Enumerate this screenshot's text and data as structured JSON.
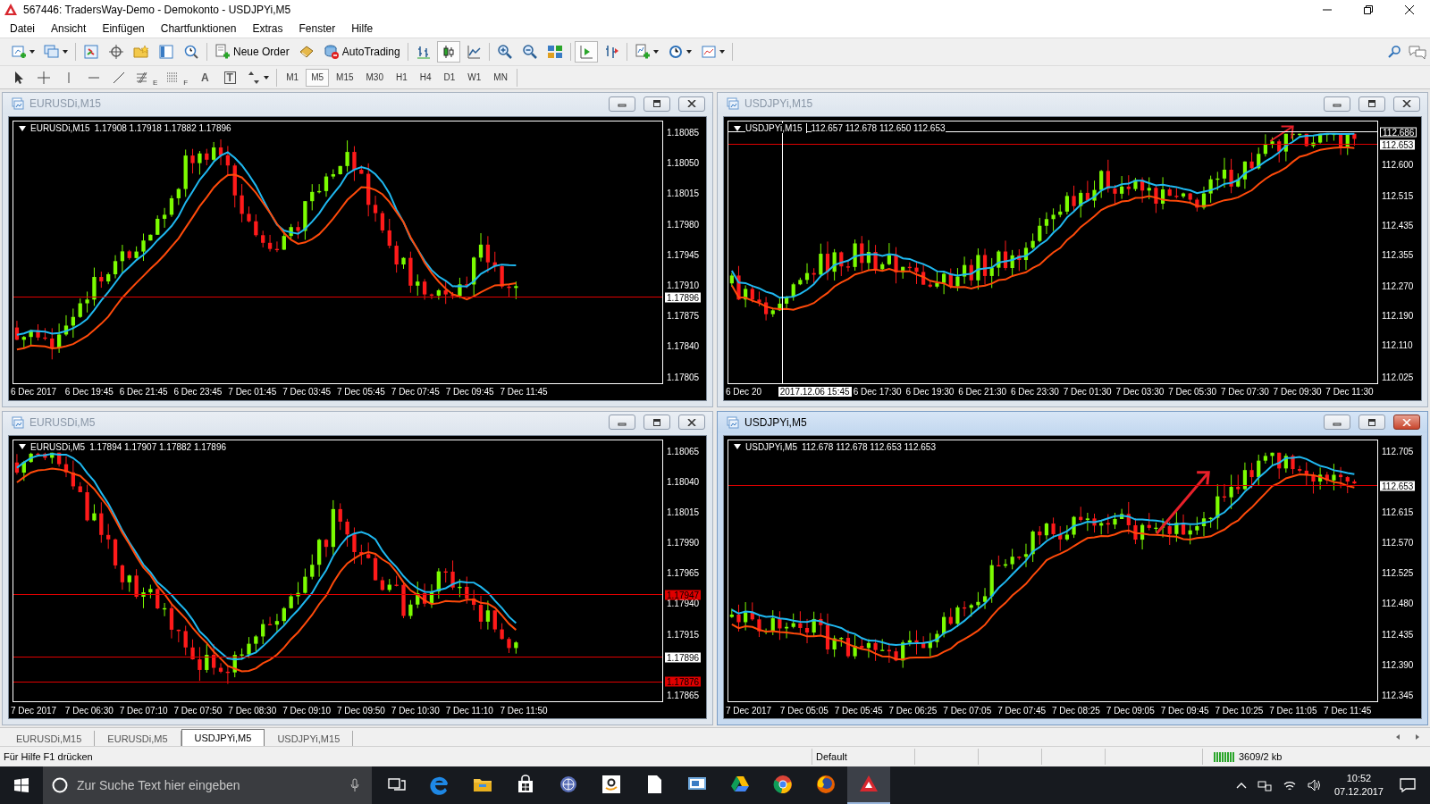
{
  "window": {
    "title": "567446: TradersWay-Demo - Demokonto - USDJPYi,M5"
  },
  "menu": [
    "Datei",
    "Ansicht",
    "Einfügen",
    "Chartfunktionen",
    "Extras",
    "Fenster",
    "Hilfe"
  ],
  "toolbar": {
    "groups": [
      [
        {
          "kind": "new-chart",
          "dropdown": true
        },
        {
          "kind": "profiles",
          "dropdown": true
        }
      ],
      [
        {
          "kind": "market-watch"
        },
        {
          "kind": "data-window"
        },
        {
          "kind": "navigator"
        },
        {
          "kind": "terminal"
        },
        {
          "kind": "tester"
        }
      ],
      [
        {
          "kind": "new-order",
          "label": "Neue Order"
        },
        {
          "kind": "editor"
        },
        {
          "kind": "autotrading",
          "label": "AutoTrading"
        }
      ],
      [
        {
          "kind": "bar-chart",
          "selected": false
        },
        {
          "kind": "candles",
          "selected": true
        },
        {
          "kind": "line-chart",
          "selected": false
        }
      ],
      [
        {
          "kind": "zoom-in"
        },
        {
          "kind": "zoom-out"
        },
        {
          "kind": "tile"
        }
      ],
      [
        {
          "kind": "autoscroll",
          "selected": true
        },
        {
          "kind": "chart-shift",
          "selected": false
        }
      ],
      [
        {
          "kind": "indicators",
          "dropdown": true
        },
        {
          "kind": "periods",
          "dropdown": true
        },
        {
          "kind": "templates",
          "dropdown": true
        }
      ]
    ]
  },
  "drawing_tools": [
    {
      "kind": "cursor"
    },
    {
      "kind": "crosshair"
    },
    {
      "kind": "vline"
    },
    {
      "kind": "hline"
    },
    {
      "kind": "trendline"
    },
    {
      "kind": "fibo",
      "label": "E"
    },
    {
      "kind": "channel",
      "label": "F"
    },
    {
      "kind": "text",
      "label": "A"
    },
    {
      "kind": "textlabel",
      "label": "T"
    },
    {
      "kind": "arrows"
    }
  ],
  "timeframes": [
    {
      "label": "M1",
      "selected": false
    },
    {
      "label": "M5",
      "selected": true
    },
    {
      "label": "M15",
      "selected": false
    },
    {
      "label": "M30",
      "selected": false
    },
    {
      "label": "H1",
      "selected": false
    },
    {
      "label": "H4",
      "selected": false
    },
    {
      "label": "D1",
      "selected": false
    },
    {
      "label": "W1",
      "selected": false
    },
    {
      "label": "MN",
      "selected": false
    }
  ],
  "charts": [
    {
      "title": "EURUSDi,M15",
      "active": false,
      "symbol": "EURUSDi,M15",
      "quote": "1.17908 1.17918 1.17882 1.17896",
      "arrow": false,
      "prices": [
        "1.18085",
        "1.18050",
        "1.18015",
        "1.17980",
        "1.17945",
        "1.17910",
        "1.17875",
        "1.17840",
        "1.17805"
      ],
      "markers": [
        {
          "kind": "bid",
          "text": "1.17896"
        }
      ],
      "times": [
        {
          "kind": "tick",
          "text": "6 Dec 2017"
        },
        {
          "kind": "tick",
          "text": "6 Dec 19:45"
        },
        {
          "kind": "tick",
          "text": "6 Dec 21:45"
        },
        {
          "kind": "tick",
          "text": "6 Dec 23:45"
        },
        {
          "kind": "tick",
          "text": "7 Dec 01:45"
        },
        {
          "kind": "tick",
          "text": "7 Dec 03:45"
        },
        {
          "kind": "tick",
          "text": "7 Dec 05:45"
        },
        {
          "kind": "tick",
          "text": "7 Dec 07:45"
        },
        {
          "kind": "tick",
          "text": "7 Dec 09:45"
        },
        {
          "kind": "tick",
          "text": "7 Dec 11:45"
        }
      ]
    },
    {
      "title": "USDJPYi,M15",
      "active": false,
      "symbol": "USDJPYi,M15",
      "quote": "112.657 112.678 112.650 112.653",
      "arrow": true,
      "prices": [
        "112.600",
        "112.515",
        "112.435",
        "112.355",
        "112.270",
        "112.190",
        "112.110",
        "112.025"
      ],
      "markers": [
        {
          "kind": "cursor",
          "text": "112.686"
        },
        {
          "kind": "bid",
          "text": "112.653"
        }
      ],
      "times": [
        {
          "kind": "tick",
          "text": "6 Dec 20"
        },
        {
          "kind": "cursor",
          "text": "2017.12.06 15:45"
        },
        {
          "kind": "tick",
          "text": "6 Dec 17:30"
        },
        {
          "kind": "tick",
          "text": "6 Dec 19:30"
        },
        {
          "kind": "tick",
          "text": "6 Dec 21:30"
        },
        {
          "kind": "tick",
          "text": "6 Dec 23:30"
        },
        {
          "kind": "tick",
          "text": "7 Dec 01:30"
        },
        {
          "kind": "tick",
          "text": "7 Dec 03:30"
        },
        {
          "kind": "tick",
          "text": "7 Dec 05:30"
        },
        {
          "kind": "tick",
          "text": "7 Dec 07:30"
        },
        {
          "kind": "tick",
          "text": "7 Dec 09:30"
        },
        {
          "kind": "tick",
          "text": "7 Dec 11:30"
        }
      ]
    },
    {
      "title": "EURUSDi,M5",
      "active": false,
      "symbol": "EURUSDi,M5",
      "quote": "1.17894 1.17907 1.17882 1.17896",
      "arrow": false,
      "prices": [
        "1.18065",
        "1.18040",
        "1.18015",
        "1.17990",
        "1.17965",
        "1.17940",
        "1.17915",
        "1.17865"
      ],
      "markers": [
        {
          "kind": "level",
          "text": "1.17947"
        },
        {
          "kind": "bid",
          "text": "1.17896"
        },
        {
          "kind": "level",
          "text": "1.17876"
        }
      ],
      "times": [
        {
          "kind": "tick",
          "text": "7 Dec 2017"
        },
        {
          "kind": "tick",
          "text": "7 Dec 06:30"
        },
        {
          "kind": "tick",
          "text": "7 Dec 07:10"
        },
        {
          "kind": "tick",
          "text": "7 Dec 07:50"
        },
        {
          "kind": "tick",
          "text": "7 Dec 08:30"
        },
        {
          "kind": "tick",
          "text": "7 Dec 09:10"
        },
        {
          "kind": "tick",
          "text": "7 Dec 09:50"
        },
        {
          "kind": "tick",
          "text": "7 Dec 10:30"
        },
        {
          "kind": "tick",
          "text": "7 Dec 11:10"
        },
        {
          "kind": "tick",
          "text": "7 Dec 11:50"
        }
      ]
    },
    {
      "title": "USDJPYi,M5",
      "active": true,
      "symbol": "USDJPYi,M5",
      "quote": "112.678 112.678 112.653 112.653",
      "arrow": true,
      "prices": [
        "112.705",
        "112.615",
        "112.570",
        "112.525",
        "112.480",
        "112.435",
        "112.390",
        "112.345"
      ],
      "markers": [
        {
          "kind": "bid",
          "text": "112.653"
        }
      ],
      "times": [
        {
          "kind": "tick",
          "text": "7 Dec 2017"
        },
        {
          "kind": "tick",
          "text": "7 Dec 05:05"
        },
        {
          "kind": "tick",
          "text": "7 Dec 05:45"
        },
        {
          "kind": "tick",
          "text": "7 Dec 06:25"
        },
        {
          "kind": "tick",
          "text": "7 Dec 07:05"
        },
        {
          "kind": "tick",
          "text": "7 Dec 07:45"
        },
        {
          "kind": "tick",
          "text": "7 Dec 08:25"
        },
        {
          "kind": "tick",
          "text": "7 Dec 09:05"
        },
        {
          "kind": "tick",
          "text": "7 Dec 09:45"
        },
        {
          "kind": "tick",
          "text": "7 Dec 10:25"
        },
        {
          "kind": "tick",
          "text": "7 Dec 11:05"
        },
        {
          "kind": "tick",
          "text": "7 Dec 11:45"
        }
      ]
    }
  ],
  "tabs": [
    {
      "label": "EURUSDi,M15",
      "selected": false
    },
    {
      "label": "EURUSDi,M5",
      "selected": false
    },
    {
      "label": "USDJPYi,M5",
      "selected": true
    },
    {
      "label": "USDJPYi,M15",
      "selected": false
    }
  ],
  "status_bar": {
    "help": "Für Hilfe F1 drücken",
    "profile": "Default",
    "traffic": "3609/2 kb"
  },
  "taskbar": {
    "search": {
      "placeholder": "Zur Suche Text hier eingeben"
    },
    "apps": [
      {
        "kind": "task-view",
        "active": false
      },
      {
        "kind": "browser",
        "active": false
      },
      {
        "kind": "folder",
        "active": false
      },
      {
        "kind": "store",
        "active": false
      },
      {
        "kind": "globe",
        "active": false
      },
      {
        "kind": "shop",
        "active": false
      },
      {
        "kind": "document",
        "active": false
      },
      {
        "kind": "remote",
        "active": false
      },
      {
        "kind": "drive",
        "active": false
      },
      {
        "kind": "chrome",
        "active": false
      },
      {
        "kind": "firefox",
        "active": false
      },
      {
        "kind": "terminal",
        "active": true
      }
    ],
    "time": "10:52",
    "date": "07.12.2017"
  }
}
